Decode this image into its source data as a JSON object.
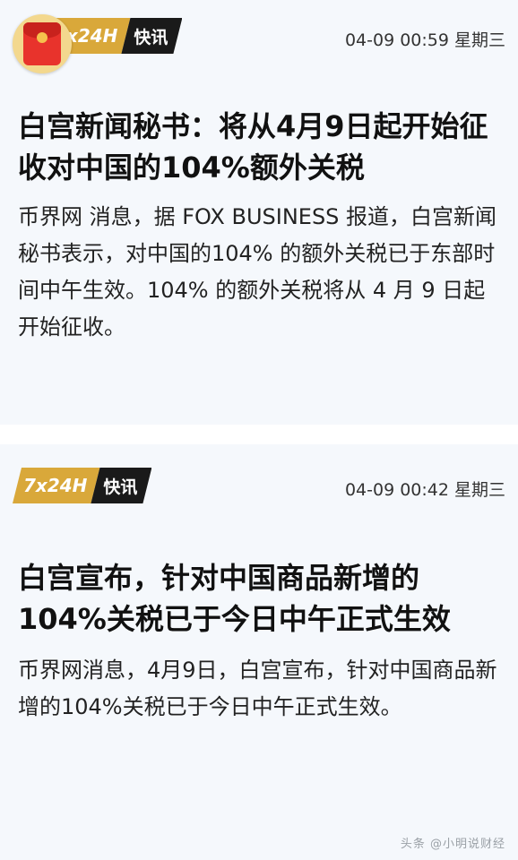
{
  "news": [
    {
      "badge_left": "7x24H",
      "badge_right": "快讯",
      "timestamp": "04-09 00:59 星期三",
      "headline": "白宫新闻秘书：将从4月9日起开始征收对中国的104%额外关税",
      "body": "币界网 消息，据 FOX BUSINESS 报道，白宫新闻秘书表示，对中国的104% 的额外关税已于东部时间中午生效。104% 的额外关税将从 4 月 9 日起开始征收。"
    },
    {
      "badge_left": "7x24H",
      "badge_right": "快讯",
      "timestamp": "04-09 00:42 星期三",
      "headline": "白宫宣布，针对中国商品新增的104%关税已于今日中午正式生效",
      "body": "币界网消息，4月9日，白宫宣布，针对中国商品新增的104%关税已于今日中午正式生效。"
    }
  ],
  "watermark": "头条 @小明说财经",
  "icons": {
    "redpacket": "red-envelope-icon"
  },
  "colors": {
    "badge_gold": "#d9a83a",
    "badge_black": "#1a1a1a",
    "card_bg": "#f5f8fc"
  }
}
